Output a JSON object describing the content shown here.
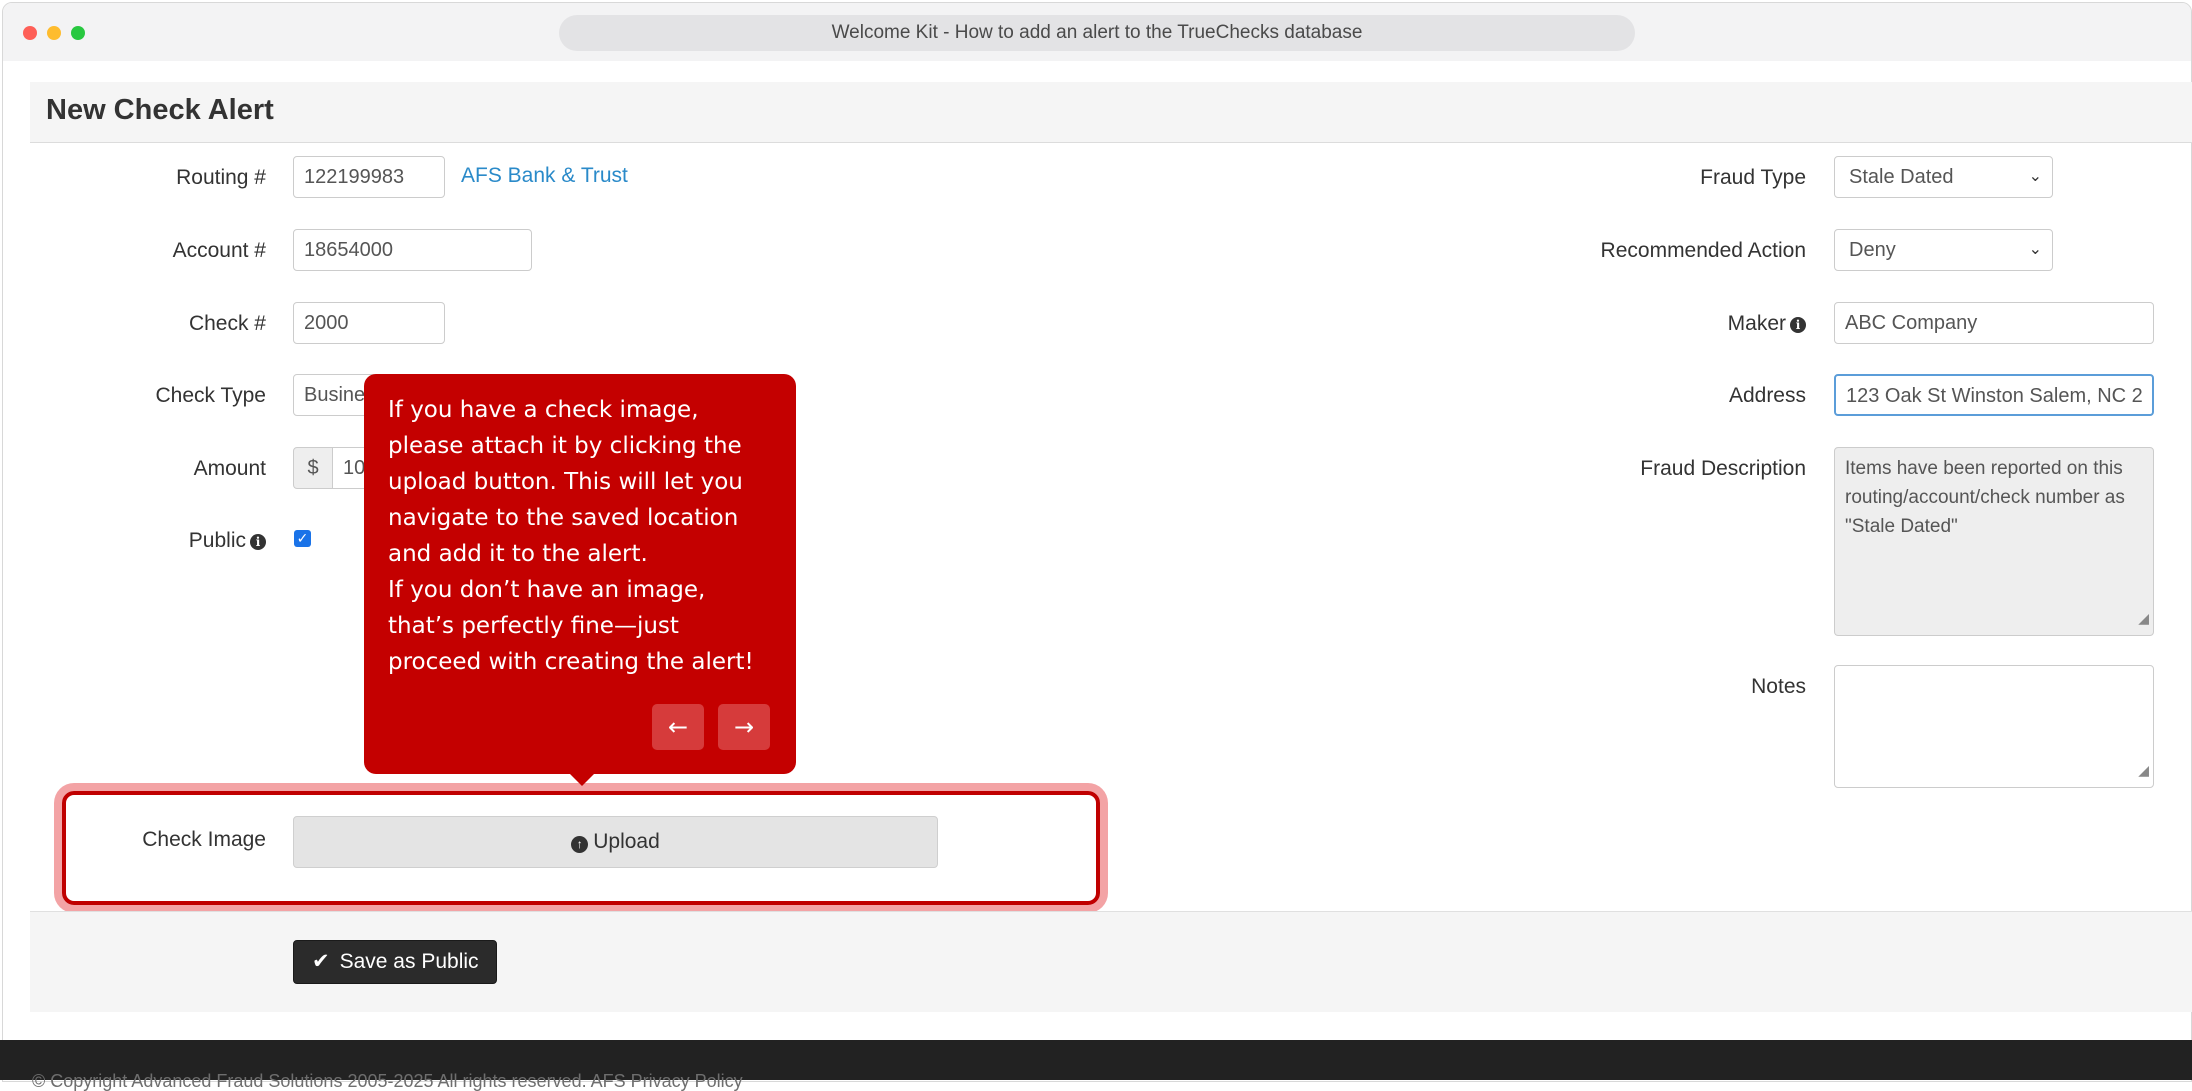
{
  "browser": {
    "url_title": "Welcome Kit - How to add an alert to the TrueChecks database"
  },
  "panel": {
    "title": "New Check Alert"
  },
  "left_form": {
    "routing": {
      "label": "Routing #",
      "value": "122199983",
      "bank_link": "AFS Bank & Trust"
    },
    "account": {
      "label": "Account #",
      "value": "18654000"
    },
    "check": {
      "label": "Check #",
      "value": "2000"
    },
    "check_type": {
      "label": "Check Type",
      "value": "Busine"
    },
    "amount": {
      "label": "Amount",
      "currency": "$",
      "value": "10"
    },
    "public": {
      "label": "Public",
      "checked": true
    },
    "check_image": {
      "label": "Check Image",
      "upload_label": "Upload"
    }
  },
  "right_form": {
    "fraud_type": {
      "label": "Fraud Type",
      "value": "Stale Dated"
    },
    "recommended_action": {
      "label": "Recommended Action",
      "value": "Deny"
    },
    "maker": {
      "label": "Maker",
      "value": "ABC Company"
    },
    "address": {
      "label": "Address",
      "value": "123 Oak St Winston Salem, NC 2"
    },
    "fraud_description": {
      "label": "Fraud Description",
      "value": "Items have been reported on this routing/account/check number as \"Stale Dated\""
    },
    "notes": {
      "label": "Notes",
      "value": ""
    }
  },
  "actions": {
    "save_label": "Save as Public"
  },
  "tooltip": {
    "paragraph1": "If you have a check image, please attach it by clicking the upload button. This will let you navigate to the saved location and add it to the alert.",
    "paragraph2": "If you don’t have an image, that’s perfectly fine—just proceed with creating the alert!",
    "prev_icon": "←",
    "next_icon": "→"
  },
  "footer": {
    "text": "© Copyright Advanced Fraud Solutions 2005-2025 All rights reserved. AFS Privacy Policy"
  },
  "colors": {
    "tooltip_bg": "#c40000",
    "highlight": "#c00000",
    "link": "#2a8ac9"
  }
}
